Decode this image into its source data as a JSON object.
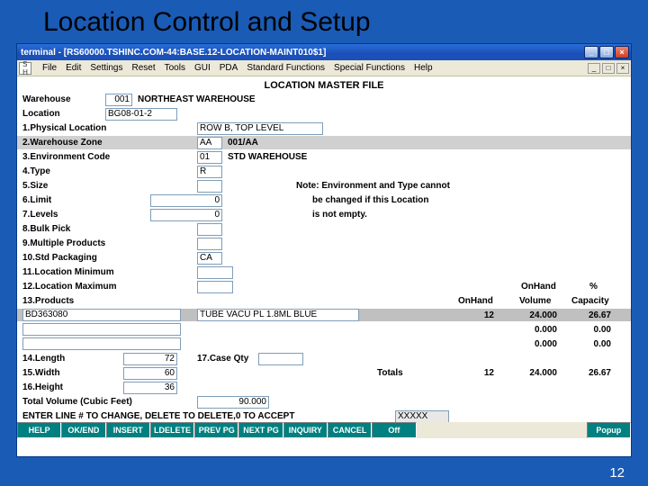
{
  "slide": {
    "title": "Location Control and Setup",
    "number": "12"
  },
  "window": {
    "title": "terminal - [RS60000.TSHINC.COM-44:BASE.12-LOCATION-MAINT010$1]",
    "menu": [
      "File",
      "Edit",
      "Settings",
      "Reset",
      "Tools",
      "GUI",
      "PDA",
      "Standard Functions",
      "Special Functions",
      "Help"
    ]
  },
  "form": {
    "title": "LOCATION MASTER FILE",
    "warehouse_lbl": "Warehouse",
    "warehouse_code": "001",
    "warehouse_name": "NORTHEAST WAREHOUSE",
    "location_lbl": "Location",
    "location": "BG08-01-2",
    "labels": {
      "l1": "1.Physical Location",
      "l2": "2.Warehouse Zone",
      "l3": "3.Environment Code",
      "l4": "4.Type",
      "l5": "5.Size",
      "l6": "6.Limit",
      "l7": "7.Levels",
      "l8": "8.Bulk Pick",
      "l9": "9.Multiple Products",
      "l10": "10.Std Packaging",
      "l11": "11.Location Minimum",
      "l12": "12.Location Maximum",
      "l13": "13.Products",
      "l14": "14.Length",
      "l15": "15.Width",
      "l16": "16.Height",
      "l17": "17.Case Qty"
    },
    "values": {
      "physical_location": "ROW B, TOP LEVEL",
      "zone_code": "AA",
      "zone_desc": "001/AA",
      "env_code": "01",
      "env_desc": "STD WAREHOUSE",
      "type": "R",
      "size": "",
      "limit": "0",
      "levels": "0",
      "bulk_pick": "",
      "multiple_products": "",
      "std_packaging": "CA",
      "loc_min": "",
      "loc_max": "",
      "length": "72",
      "width": "60",
      "height": "36",
      "case_qty": ""
    },
    "note1": "Note: Environment and Type cannot",
    "note2": "be changed if this Location",
    "note3": "is not empty.",
    "col_onhand": "OnHand",
    "col_onhand2": "OnHand",
    "col_volume": "Volume",
    "col_pct": "%",
    "col_capacity": "Capacity",
    "product_code": "BD363080",
    "product_desc": "TUBE VACU PL 1.8ML BLUE",
    "p_onhand": "12",
    "p_volume": "24.000",
    "p_capacity": "26.67",
    "r2_volume": "0.000",
    "r2_capacity": "0.00",
    "r3_volume": "0.000",
    "r3_capacity": "0.00",
    "totals_lbl": "Totals",
    "t_onhand": "12",
    "t_volume": "24.000",
    "t_capacity": "26.67",
    "total_vol_lbl": "Total Volume (Cubic Feet)",
    "total_vol": "90.000",
    "prompt": "ENTER LINE # TO CHANGE, DELETE TO DELETE,0 TO ACCEPT",
    "prompt_val": "XXXXX"
  },
  "buttons": [
    "HELP",
    "OK/END",
    "INSERT",
    "LDELETE",
    "PREV PG",
    "NEXT PG",
    "INQUIRY",
    "CANCEL",
    "Off",
    "Popup"
  ]
}
